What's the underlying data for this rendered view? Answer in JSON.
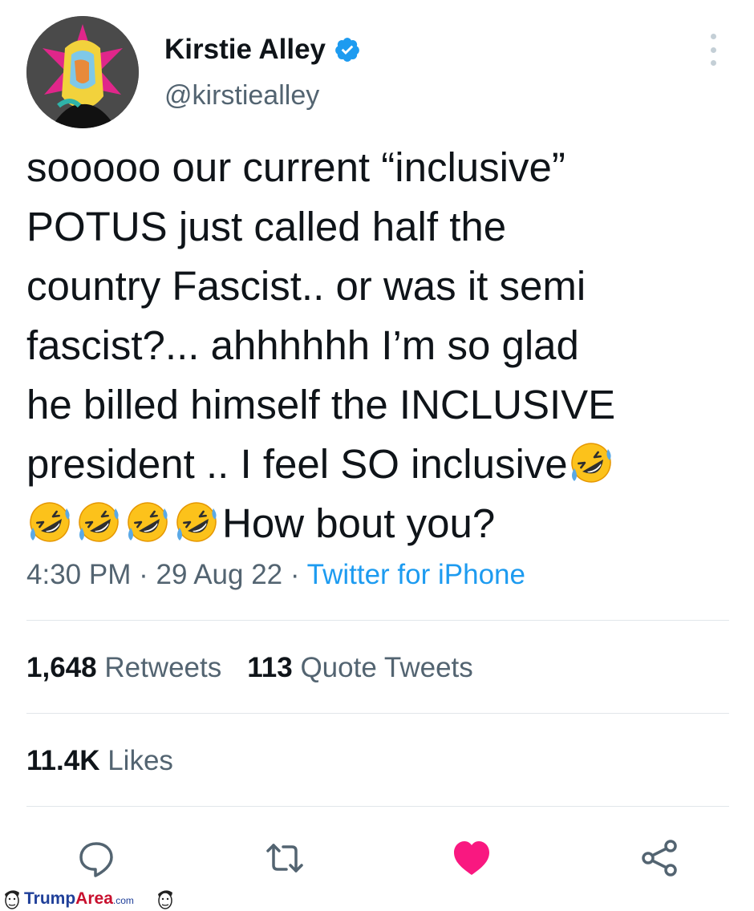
{
  "tweet": {
    "author_name": "Kirstie Alley",
    "author_handle": "@kirstiealley",
    "text_lines": [
      "sooooo our current “inclusive”",
      "POTUS just called half the",
      "country Fascist.. or was it semi",
      "fascist?... ahhhhhh I’m so glad",
      "he billed himself the INCLUSIVE",
      "president .. I feel SO inclusive",
      "How bout you?"
    ],
    "emoji": "rolling-on-floor-laughing",
    "time": "4:30 PM",
    "date": "29 Aug 22",
    "separator": "·",
    "source": "Twitter for iPhone"
  },
  "stats": {
    "retweets_count": "1,648",
    "retweets_label": "Retweets",
    "quotes_count": "113",
    "quotes_label": "Quote Tweets",
    "likes_count": "11.4K",
    "likes_label": "Likes"
  },
  "icons": {
    "reply": "reply-icon",
    "retweet": "retweet-icon",
    "like": "heart-icon",
    "share": "share-icon",
    "more": "more-icon",
    "verified": "verified-badge-icon"
  },
  "colors": {
    "text": "#0f1419",
    "secondary": "#536471",
    "link": "#1d9bf0",
    "like": "#f91880",
    "verified": "#1d9bf0"
  },
  "watermark": {
    "part1": "Trump",
    "part2": "Area",
    "part3": ".com"
  }
}
